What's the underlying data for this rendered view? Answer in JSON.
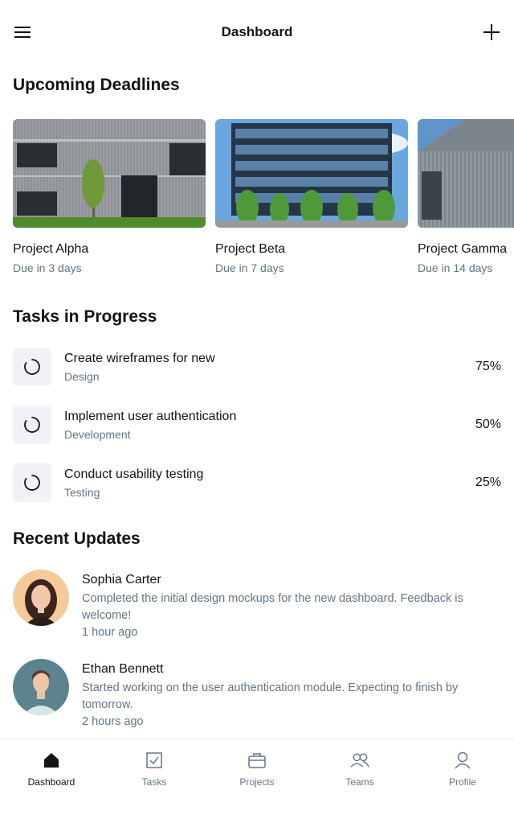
{
  "header": {
    "title": "Dashboard",
    "menu_icon": "menu-icon",
    "add_icon": "plus-icon"
  },
  "sections": {
    "deadlines": "Upcoming Deadlines",
    "tasks": "Tasks in Progress",
    "updates": "Recent Updates"
  },
  "deadlines": [
    {
      "name": "Project Alpha",
      "due": "Due in 3 days"
    },
    {
      "name": "Project Beta",
      "due": "Due in 7 days"
    },
    {
      "name": "Project Gamma",
      "due": "Due in 14 days"
    }
  ],
  "tasks": [
    {
      "title": "Create wireframes for new",
      "category": "Design",
      "progress": "75%"
    },
    {
      "title": "Implement user authentication",
      "category": "Development",
      "progress": "50%"
    },
    {
      "title": "Conduct usability testing",
      "category": "Testing",
      "progress": "25%"
    }
  ],
  "updates": [
    {
      "name": "Sophia Carter",
      "text": "Completed the initial design mockups for the new dashboard. Feedback is welcome!",
      "time": "1 hour ago"
    },
    {
      "name": "Ethan Bennett",
      "text": "Started working on the user authentication module. Expecting to finish by tomorrow.",
      "time": "2 hours ago"
    }
  ],
  "nav": [
    {
      "label": "Dashboard",
      "icon": "home-icon",
      "active": true
    },
    {
      "label": "Tasks",
      "icon": "checkbox-icon",
      "active": false
    },
    {
      "label": "Projects",
      "icon": "briefcase-icon",
      "active": false
    },
    {
      "label": "Teams",
      "icon": "users-icon",
      "active": false
    },
    {
      "label": "Profile",
      "icon": "user-icon",
      "active": false
    }
  ],
  "colors": {
    "text_primary": "#121417",
    "text_secondary": "#637587",
    "icon_bg": "#f0f2f5"
  }
}
